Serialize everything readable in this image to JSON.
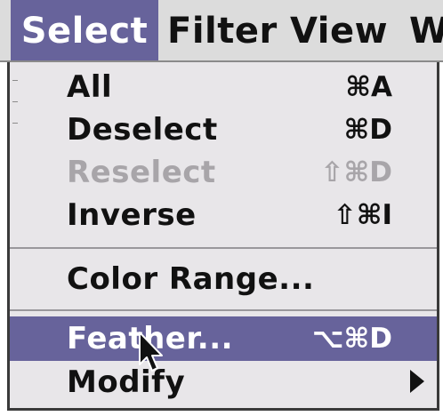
{
  "menubar": {
    "items": [
      {
        "label": "Select",
        "selected": true
      },
      {
        "label": "Filter"
      },
      {
        "label": "View"
      },
      {
        "label": "W"
      }
    ]
  },
  "menu": {
    "items": [
      {
        "label": "All",
        "shortcut": "⌘A",
        "enabled": true
      },
      {
        "label": "Deselect",
        "shortcut": "⌘D",
        "enabled": true
      },
      {
        "label": "Reselect",
        "shortcut": "⇧⌘D",
        "enabled": false
      },
      {
        "label": "Inverse",
        "shortcut": "⇧⌘I",
        "enabled": true
      },
      {
        "label": "Color Range...",
        "shortcut": "",
        "enabled": true
      },
      {
        "label": "Feather...",
        "shortcut": "⌥⌘D",
        "enabled": true,
        "highlighted": true
      },
      {
        "label": "Modify",
        "shortcut": "",
        "enabled": true,
        "submenu": true,
        "submenu_icon": "triangle-right-icon"
      }
    ]
  },
  "colors": {
    "highlight": "#67639b",
    "menu_background": "#e8e6e9",
    "disabled_text": "#a8a5a9"
  },
  "icons": {
    "pointer": "arrow-cursor-icon"
  }
}
